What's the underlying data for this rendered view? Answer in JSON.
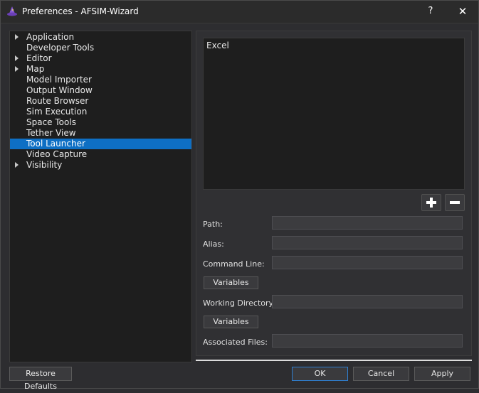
{
  "window": {
    "title": "Preferences - AFSIM-Wizard",
    "help_label": "?",
    "close_label": "✕"
  },
  "tree": {
    "items": [
      {
        "label": "Application",
        "expandable": true,
        "selected": false
      },
      {
        "label": "Developer Tools",
        "expandable": false,
        "selected": false
      },
      {
        "label": "Editor",
        "expandable": true,
        "selected": false
      },
      {
        "label": "Map",
        "expandable": true,
        "selected": false
      },
      {
        "label": "Model Importer",
        "expandable": false,
        "selected": false
      },
      {
        "label": "Output Window",
        "expandable": false,
        "selected": false
      },
      {
        "label": "Route Browser",
        "expandable": false,
        "selected": false
      },
      {
        "label": "Sim Execution",
        "expandable": false,
        "selected": false
      },
      {
        "label": "Space Tools",
        "expandable": false,
        "selected": false
      },
      {
        "label": "Tether View",
        "expandable": false,
        "selected": false
      },
      {
        "label": "Tool Launcher",
        "expandable": false,
        "selected": true
      },
      {
        "label": "Video Capture",
        "expandable": false,
        "selected": false
      },
      {
        "label": "Visibility",
        "expandable": true,
        "selected": false
      }
    ]
  },
  "tool_launcher": {
    "tools": [
      "Excel"
    ],
    "path_label": "Path:",
    "path_value": "",
    "alias_label": "Alias:",
    "alias_value": "",
    "command_line_label": "Command Line:",
    "command_line_value": "",
    "variables_label_1": "Variables",
    "working_directory_label": "Working Directory:",
    "working_directory_value": "",
    "variables_label_2": "Variables",
    "associated_files_label": "Associated Files:",
    "associated_files_value": ""
  },
  "buttons": {
    "restore_defaults": "Restore Defaults",
    "ok": "OK",
    "cancel": "Cancel",
    "apply": "Apply"
  },
  "colors": {
    "selection": "#0e6fc4",
    "background": "#2d2d30",
    "list_background": "#1e1e1e"
  }
}
